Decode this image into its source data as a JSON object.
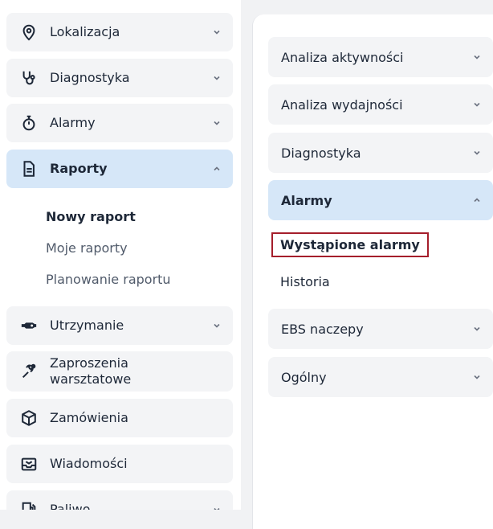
{
  "sidebar": {
    "items": [
      {
        "label": "Lokalizacja",
        "icon": "location-pin-icon"
      },
      {
        "label": "Diagnostyka",
        "icon": "stethoscope-icon"
      },
      {
        "label": "Alarmy",
        "icon": "stopwatch-icon"
      },
      {
        "label": "Raporty",
        "icon": "report-document-icon"
      },
      {
        "label": "Utrzymanie",
        "icon": "wrench-icon"
      },
      {
        "label": "Zaproszenia warsztatowe",
        "label_line1": "Zaproszenia",
        "label_line2": "warsztatowe",
        "icon": "workshop-invite-icon"
      },
      {
        "label": "Zamówienia",
        "icon": "package-icon"
      },
      {
        "label": "Wiadomości",
        "icon": "message-icon"
      },
      {
        "label": "Paliwo",
        "icon": "fuel-icon"
      }
    ],
    "raporty_sub": {
      "new_report": "Nowy raport",
      "my_reports": "Moje raporty",
      "planning": "Planowanie raportu"
    }
  },
  "panel": {
    "items": [
      {
        "label": "Analiza aktywności"
      },
      {
        "label": "Analiza wydajności"
      },
      {
        "label": "Diagnostyka"
      },
      {
        "label": "Alarmy"
      },
      {
        "label": "EBS naczepy"
      },
      {
        "label": "Ogólny"
      }
    ],
    "alarmy_sub": {
      "occurred": "Wystąpione alarmy",
      "history": "Historia"
    }
  },
  "colors": {
    "active_bg": "#d6e7f8",
    "item_bg": "#f3f4f6",
    "highlight_border": "#a51e2b",
    "icon_color": "#1e2838"
  }
}
